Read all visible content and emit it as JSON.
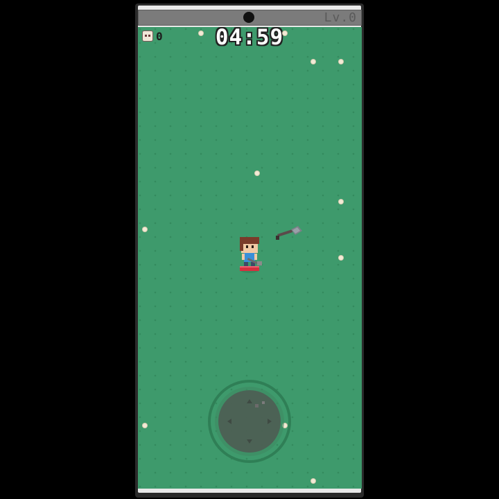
{
  "hud": {
    "level": "Lv.0",
    "timer": "04:59",
    "kill_count": "0"
  },
  "icons": {
    "kills": "skull-icon",
    "weapon": "shovel-icon"
  },
  "colors": {
    "grass": "#3e9a6c",
    "flower": "#f3ead6",
    "player_shirt": "#3a8fd8",
    "player_hair": "#7a3b2a"
  }
}
